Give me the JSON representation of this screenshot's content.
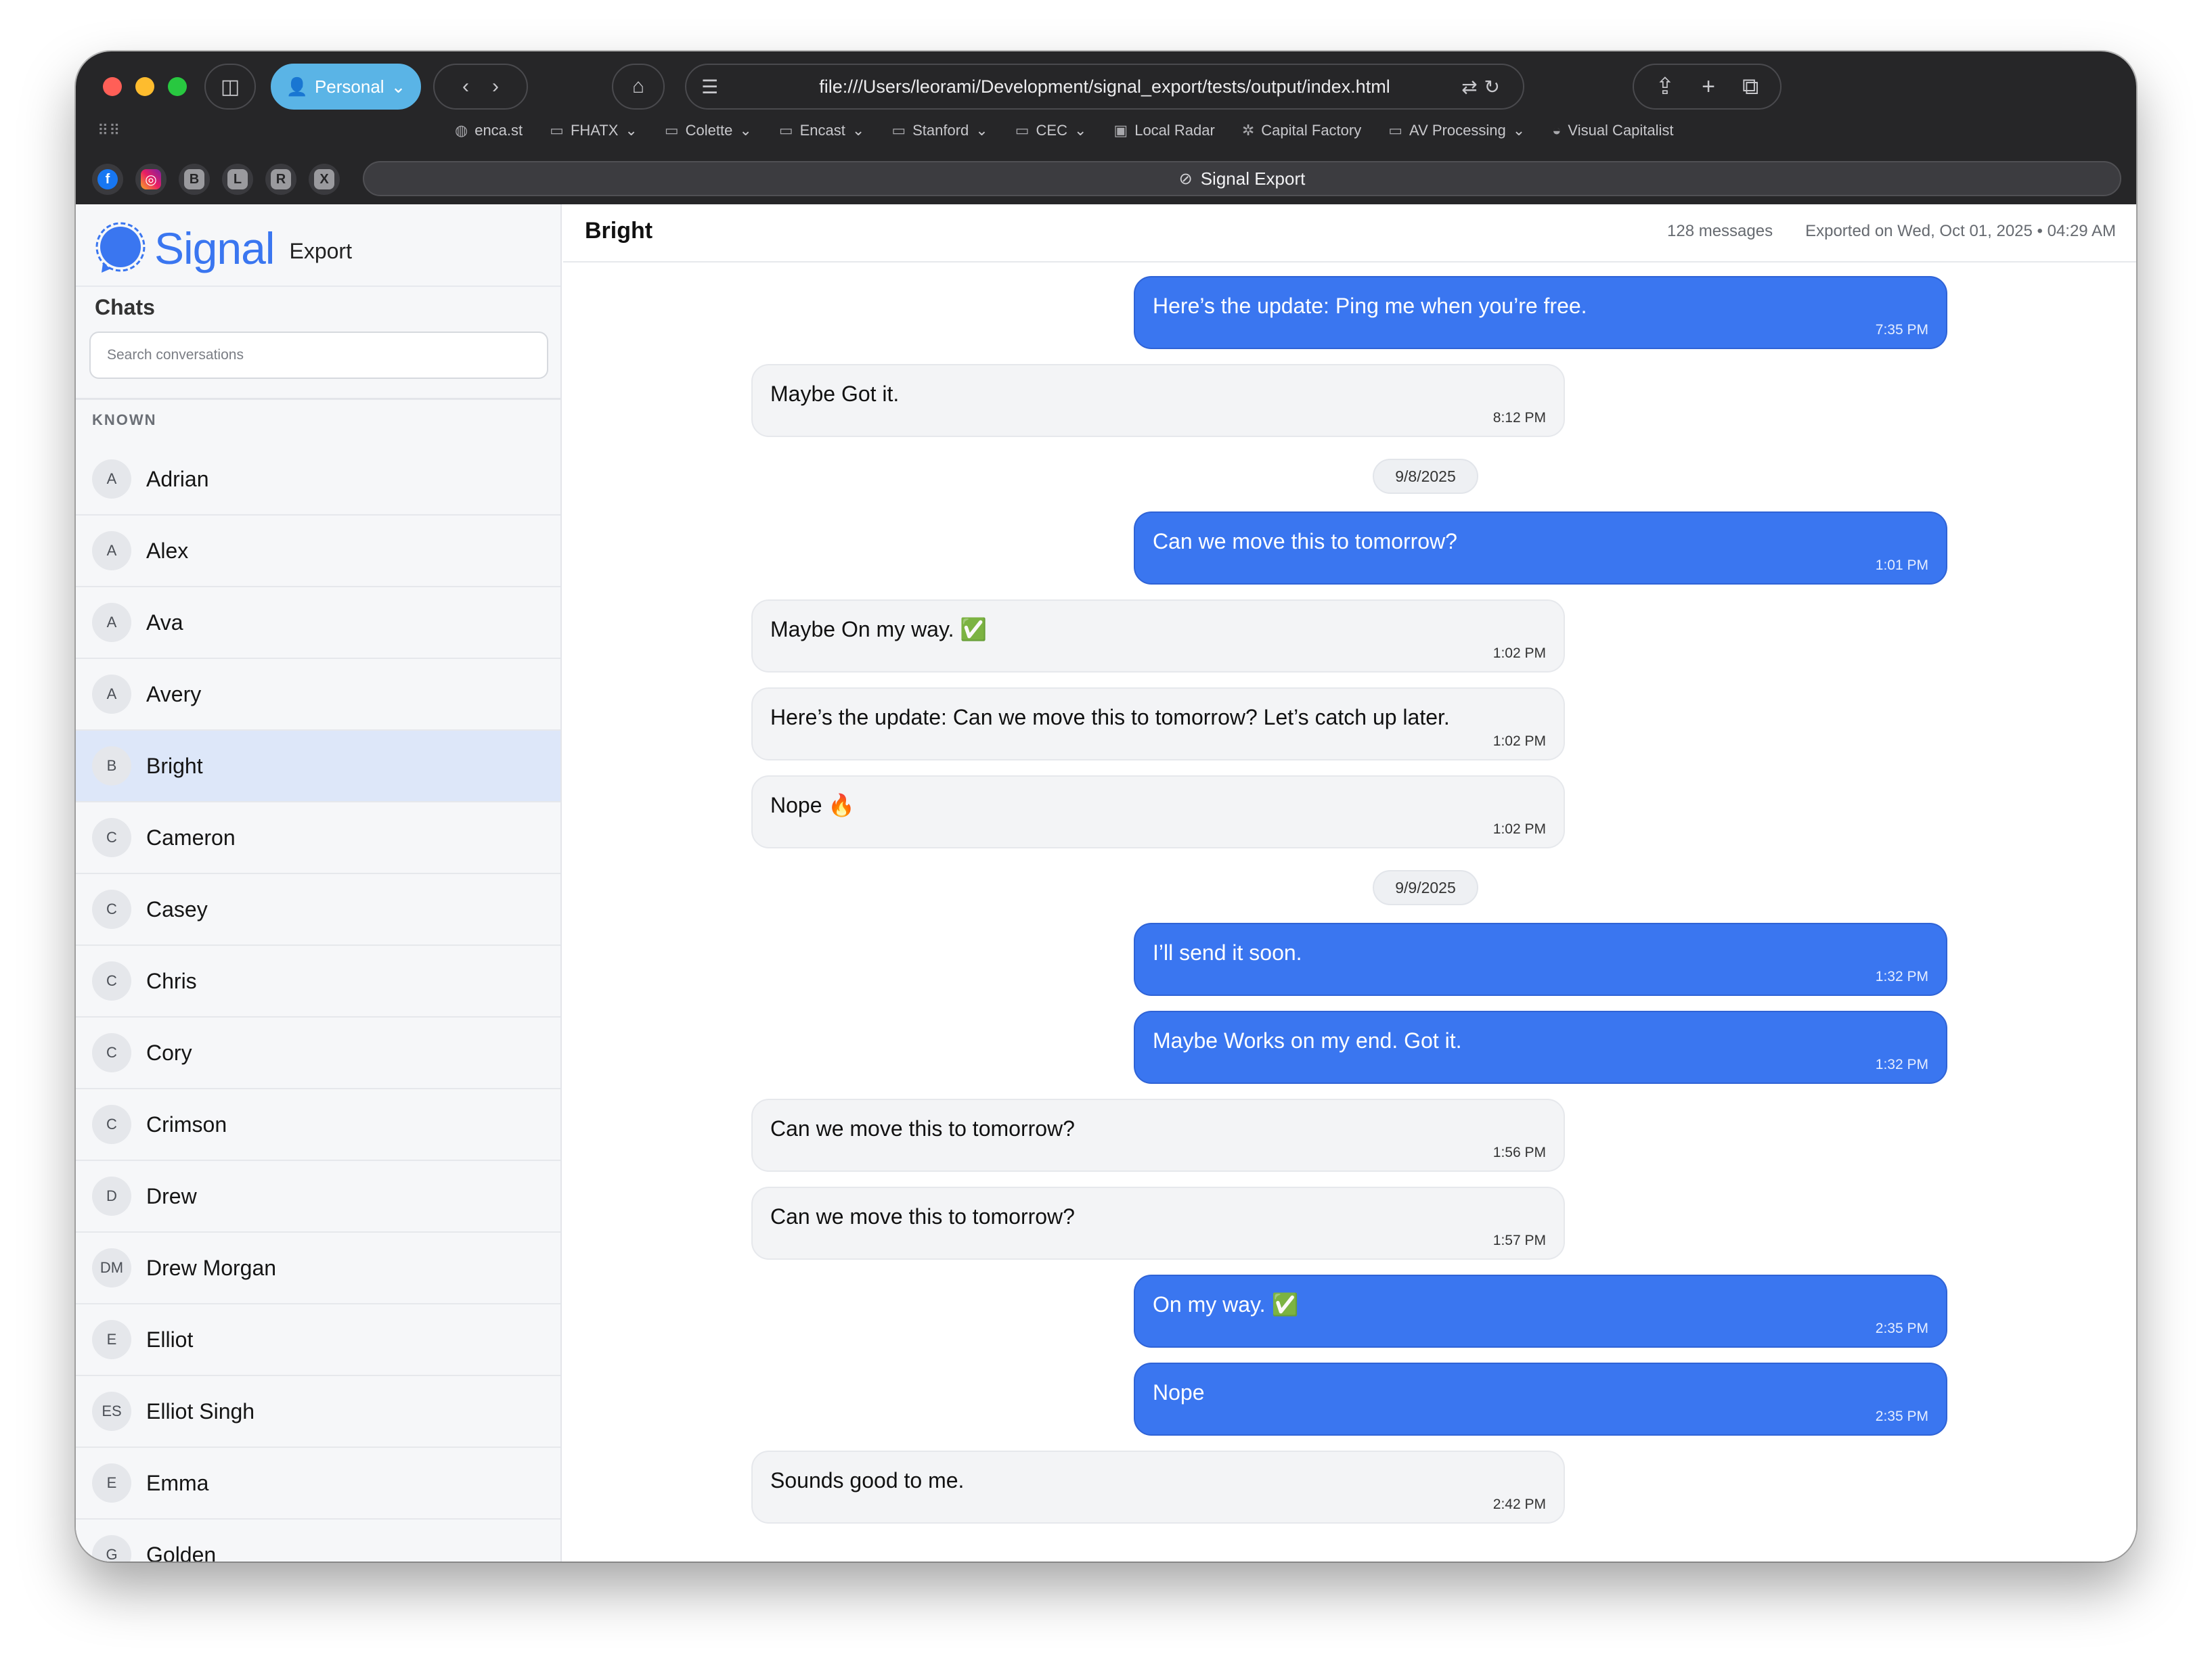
{
  "browser": {
    "profile_label": "Personal",
    "url": "file:///Users/leorami/Development/signal_export/tests/output/index.html",
    "tab_title": "Signal Export",
    "bookmarks": [
      {
        "label": "enca.st",
        "icon": "globe-icon"
      },
      {
        "label": "FHATX",
        "icon": "folder-icon",
        "dropdown": true
      },
      {
        "label": "Colette",
        "icon": "folder-icon",
        "dropdown": true
      },
      {
        "label": "Encast",
        "icon": "folder-icon",
        "dropdown": true
      },
      {
        "label": "Stanford",
        "icon": "folder-icon",
        "dropdown": true
      },
      {
        "label": "CEC",
        "icon": "folder-icon",
        "dropdown": true
      },
      {
        "label": "Local Radar",
        "icon": "radar-icon"
      },
      {
        "label": "Capital Factory",
        "icon": "star-icon"
      },
      {
        "label": "AV Processing",
        "icon": "folder-icon",
        "dropdown": true
      },
      {
        "label": "Visual Capitalist",
        "icon": "site-icon"
      }
    ],
    "pinned_tabs": [
      "f",
      "◎",
      "B",
      "L",
      "R",
      "X"
    ]
  },
  "sidebar": {
    "brand_name": "Signal",
    "brand_subtitle": "Export",
    "chats_title": "Chats",
    "search_placeholder": "Search conversations",
    "section_label": "KNOWN",
    "contacts": [
      {
        "initials": "A",
        "name": "Adrian"
      },
      {
        "initials": "A",
        "name": "Alex"
      },
      {
        "initials": "A",
        "name": "Ava"
      },
      {
        "initials": "A",
        "name": "Avery"
      },
      {
        "initials": "B",
        "name": "Bright",
        "active": true
      },
      {
        "initials": "C",
        "name": "Cameron"
      },
      {
        "initials": "C",
        "name": "Casey"
      },
      {
        "initials": "C",
        "name": "Chris"
      },
      {
        "initials": "C",
        "name": "Cory"
      },
      {
        "initials": "C",
        "name": "Crimson"
      },
      {
        "initials": "D",
        "name": "Drew"
      },
      {
        "initials": "DM",
        "name": "Drew Morgan"
      },
      {
        "initials": "E",
        "name": "Elliot"
      },
      {
        "initials": "ES",
        "name": "Elliot Singh"
      },
      {
        "initials": "E",
        "name": "Emma"
      },
      {
        "initials": "G",
        "name": "Golden"
      }
    ]
  },
  "chat": {
    "title": "Bright",
    "message_count": "128 messages",
    "exported_on": "Exported on Wed, Oct 01, 2025 • 04:29 AM",
    "items": [
      {
        "kind": "message",
        "dir": "out",
        "text": "Here’s the update: Ping me when you’re free.",
        "time": "7:35 PM"
      },
      {
        "kind": "message",
        "dir": "in",
        "text": "Maybe Got it.",
        "time": "8:12 PM"
      },
      {
        "kind": "date",
        "text": "9/8/2025"
      },
      {
        "kind": "message",
        "dir": "out",
        "text": "Can we move this to tomorrow?",
        "time": "1:01 PM"
      },
      {
        "kind": "message",
        "dir": "in",
        "text": "Maybe On my way. ✅",
        "time": "1:02 PM"
      },
      {
        "kind": "message",
        "dir": "in",
        "text": "Here’s the update: Can we move this to tomorrow? Let’s catch up later.",
        "time": "1:02 PM"
      },
      {
        "kind": "message",
        "dir": "in",
        "text": "Nope 🔥",
        "time": "1:02 PM"
      },
      {
        "kind": "date",
        "text": "9/9/2025"
      },
      {
        "kind": "message",
        "dir": "out",
        "text": "I’ll send it soon.",
        "time": "1:32 PM"
      },
      {
        "kind": "message",
        "dir": "out",
        "text": "Maybe Works on my end. Got it.",
        "time": "1:32 PM"
      },
      {
        "kind": "message",
        "dir": "in",
        "text": "Can we move this to tomorrow?",
        "time": "1:56 PM"
      },
      {
        "kind": "message",
        "dir": "in",
        "text": "Can we move this to tomorrow?",
        "time": "1:57 PM"
      },
      {
        "kind": "message",
        "dir": "out",
        "text": "On my way. ✅",
        "time": "2:35 PM"
      },
      {
        "kind": "message",
        "dir": "out",
        "text": "Nope",
        "time": "2:35 PM"
      },
      {
        "kind": "message",
        "dir": "in",
        "text": "Sounds good to me.",
        "time": "2:42 PM"
      }
    ]
  },
  "colors": {
    "signal_blue": "#3a76f0",
    "active_contact_bg": "#dde7f9",
    "incoming_bubble": "#f3f4f6",
    "chrome_bg": "#262628",
    "profile_button": "#5ab4e6"
  }
}
